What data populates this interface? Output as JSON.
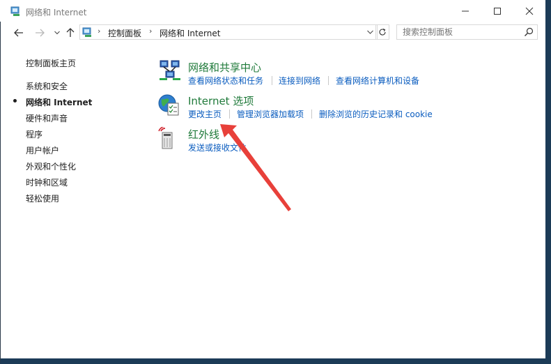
{
  "window": {
    "title": "网络和 Internet",
    "controls": {
      "minimize": "minimize-icon",
      "maximize": "maximize-icon",
      "close": "close-icon"
    }
  },
  "nav": {
    "back_icon": "back-arrow-icon",
    "forward_icon": "forward-arrow-icon",
    "up_icon": "up-arrow-icon",
    "breadcrumb": [
      "控制面板",
      "网络和 Internet"
    ],
    "search_placeholder": "搜索控制面板"
  },
  "sidebar": {
    "home": "控制面板主页",
    "items": [
      {
        "label": "系统和安全",
        "current": false
      },
      {
        "label": "网络和 Internet",
        "current": true
      },
      {
        "label": "硬件和声音",
        "current": false
      },
      {
        "label": "程序",
        "current": false
      },
      {
        "label": "用户帐户",
        "current": false
      },
      {
        "label": "外观和个性化",
        "current": false
      },
      {
        "label": "时钟和区域",
        "current": false
      },
      {
        "label": "轻松使用",
        "current": false
      }
    ]
  },
  "categories": [
    {
      "title": "网络和共享中心",
      "icon": "network-sharing-icon",
      "links": [
        "查看网络状态和任务",
        "连接到网络",
        "查看网络计算机和设备"
      ]
    },
    {
      "title": "Internet 选项",
      "icon": "internet-options-icon",
      "links": [
        "更改主页",
        "管理浏览器加载项",
        "删除浏览的历史记录和 cookie"
      ]
    },
    {
      "title": "红外线",
      "icon": "infrared-icon",
      "links": [
        "发送或接收文件"
      ]
    }
  ],
  "colors": {
    "category_title": "#1f7a3a",
    "link": "#0a5cbf",
    "annotation_arrow": "#e8403a",
    "window_border": "#1c3b57"
  },
  "annotation": {
    "type": "arrow",
    "points_to": "更改主页"
  }
}
